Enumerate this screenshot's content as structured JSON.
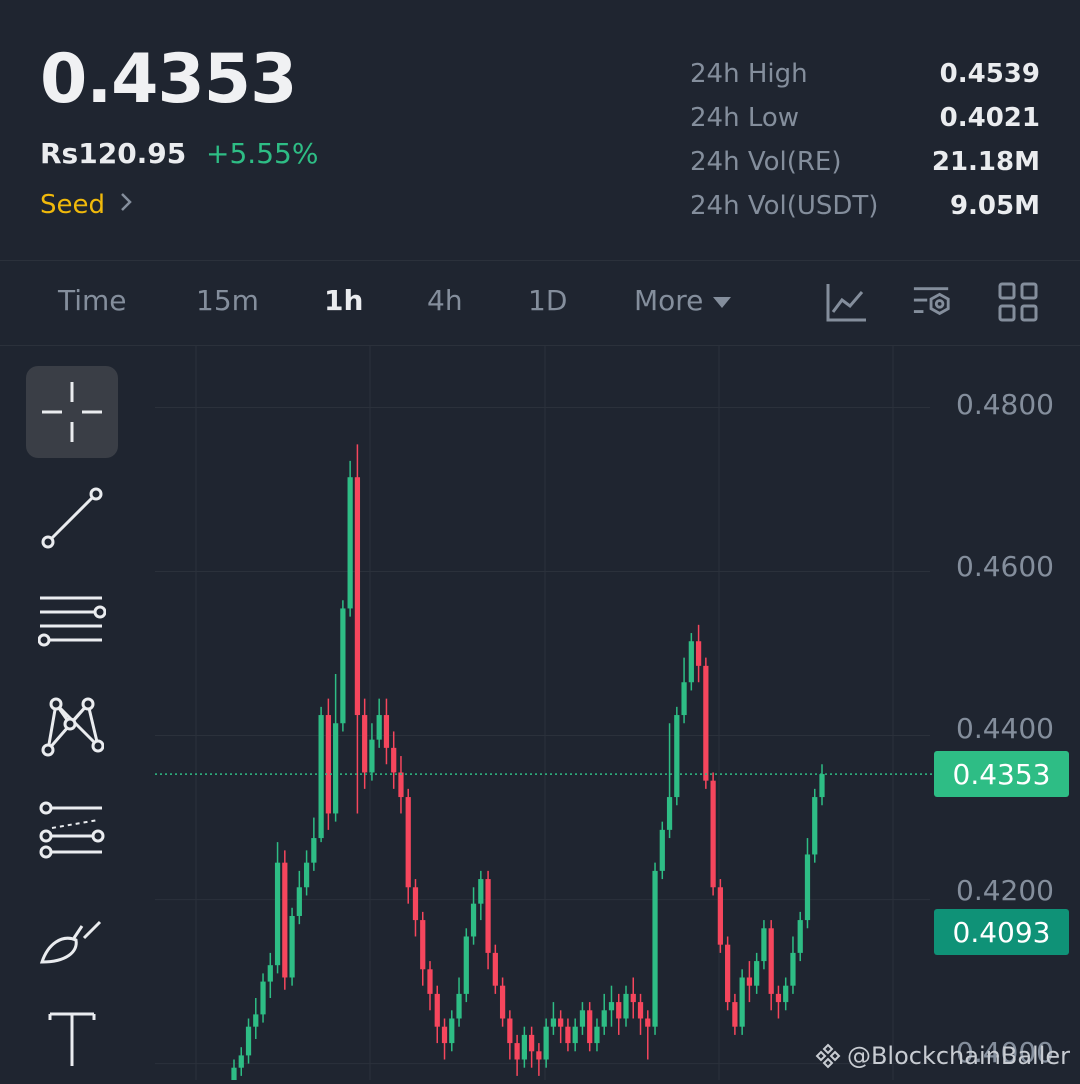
{
  "header": {
    "price": "0.4353",
    "fiat_price": "Rs120.95",
    "change": "+5.55%",
    "tag": "Seed",
    "stats": [
      {
        "label": "24h High",
        "value": "0.4539"
      },
      {
        "label": "24h Low",
        "value": "0.4021"
      },
      {
        "label": "24h Vol(RE)",
        "value": "21.18M"
      },
      {
        "label": "24h Vol(USDT)",
        "value": "9.05M"
      }
    ]
  },
  "tabs": {
    "items": [
      "Time",
      "15m",
      "1h",
      "4h",
      "1D",
      "More"
    ],
    "active": "1h"
  },
  "toolbar_icons": [
    "indicator-chart-icon",
    "settings-filter-icon",
    "layout-grid-icon"
  ],
  "sidebar_tools": [
    "crosshair-icon",
    "trend-line-icon",
    "horizontal-lines-icon",
    "pattern-icon",
    "fib-channel-icon",
    "brush-icon",
    "text-icon"
  ],
  "chart_data": {
    "type": "candlestick",
    "y_ticks": [
      "0.4800",
      "0.4600",
      "0.4400",
      "0.4200",
      "0.4000"
    ],
    "y_tick_values": [
      0.48,
      0.46,
      0.44,
      0.42,
      0.4
    ],
    "ylim": [
      0.398,
      0.4875
    ],
    "current_price": "0.4353",
    "current_price_value": 0.4353,
    "secondary_price": "0.4093",
    "secondary_price_value": 0.4093,
    "colors": {
      "up": "#2ebd85",
      "down": "#f6465d"
    },
    "candles": [
      [
        0.398,
        0.3995,
        0.397,
        0.4005
      ],
      [
        0.3995,
        0.401,
        0.3985,
        0.402
      ],
      [
        0.401,
        0.4045,
        0.4,
        0.4055
      ],
      [
        0.4045,
        0.406,
        0.403,
        0.408
      ],
      [
        0.406,
        0.41,
        0.405,
        0.411
      ],
      [
        0.41,
        0.412,
        0.408,
        0.4135
      ],
      [
        0.412,
        0.4245,
        0.411,
        0.427
      ],
      [
        0.4245,
        0.4105,
        0.409,
        0.426
      ],
      [
        0.4105,
        0.418,
        0.4095,
        0.419
      ],
      [
        0.418,
        0.4215,
        0.417,
        0.4235
      ],
      [
        0.4215,
        0.4245,
        0.4205,
        0.426
      ],
      [
        0.4245,
        0.4275,
        0.4235,
        0.43
      ],
      [
        0.4275,
        0.4425,
        0.427,
        0.4435
      ],
      [
        0.4425,
        0.4305,
        0.4285,
        0.4445
      ],
      [
        0.4305,
        0.4415,
        0.4295,
        0.4475
      ],
      [
        0.4415,
        0.4555,
        0.4405,
        0.4565
      ],
      [
        0.4555,
        0.4715,
        0.4545,
        0.4735
      ],
      [
        0.4715,
        0.4425,
        0.4305,
        0.4755
      ],
      [
        0.4425,
        0.4355,
        0.4335,
        0.4445
      ],
      [
        0.4355,
        0.4395,
        0.4345,
        0.4415
      ],
      [
        0.4395,
        0.4425,
        0.4385,
        0.4445
      ],
      [
        0.4425,
        0.4385,
        0.4365,
        0.4445
      ],
      [
        0.4385,
        0.4355,
        0.4335,
        0.4405
      ],
      [
        0.4355,
        0.4325,
        0.4305,
        0.4375
      ],
      [
        0.4325,
        0.4215,
        0.4195,
        0.4335
      ],
      [
        0.4215,
        0.4175,
        0.4155,
        0.4225
      ],
      [
        0.4175,
        0.4115,
        0.4095,
        0.4185
      ],
      [
        0.4115,
        0.4085,
        0.4065,
        0.4125
      ],
      [
        0.4085,
        0.4045,
        0.4025,
        0.4095
      ],
      [
        0.4045,
        0.4025,
        0.4005,
        0.4055
      ],
      [
        0.4025,
        0.4055,
        0.4015,
        0.4065
      ],
      [
        0.4055,
        0.4085,
        0.4045,
        0.4105
      ],
      [
        0.4085,
        0.4155,
        0.4075,
        0.4165
      ],
      [
        0.4155,
        0.4195,
        0.4145,
        0.4215
      ],
      [
        0.4195,
        0.4225,
        0.4175,
        0.4235
      ],
      [
        0.4225,
        0.4135,
        0.4115,
        0.4235
      ],
      [
        0.4135,
        0.4095,
        0.4085,
        0.4145
      ],
      [
        0.4095,
        0.4055,
        0.4045,
        0.4105
      ],
      [
        0.4055,
        0.4025,
        0.4005,
        0.4065
      ],
      [
        0.4025,
        0.4005,
        0.3985,
        0.4035
      ],
      [
        0.4005,
        0.4035,
        0.3995,
        0.4045
      ],
      [
        0.4035,
        0.4015,
        0.3995,
        0.4045
      ],
      [
        0.4015,
        0.4005,
        0.3985,
        0.4025
      ],
      [
        0.4005,
        0.4045,
        0.3995,
        0.4055
      ],
      [
        0.4045,
        0.4055,
        0.4035,
        0.4075
      ],
      [
        0.4055,
        0.4045,
        0.4025,
        0.4065
      ],
      [
        0.4045,
        0.4025,
        0.4015,
        0.4055
      ],
      [
        0.4025,
        0.4045,
        0.4015,
        0.4055
      ],
      [
        0.4045,
        0.4065,
        0.4035,
        0.4075
      ],
      [
        0.4065,
        0.4025,
        0.4015,
        0.4075
      ],
      [
        0.4025,
        0.4045,
        0.4015,
        0.4055
      ],
      [
        0.4045,
        0.4065,
        0.4035,
        0.4085
      ],
      [
        0.4065,
        0.4075,
        0.4045,
        0.4095
      ],
      [
        0.4075,
        0.4055,
        0.4035,
        0.4085
      ],
      [
        0.4055,
        0.4085,
        0.4045,
        0.4095
      ],
      [
        0.4085,
        0.4075,
        0.4055,
        0.4105
      ],
      [
        0.4075,
        0.4055,
        0.4035,
        0.4085
      ],
      [
        0.4055,
        0.4045,
        0.4005,
        0.4065
      ],
      [
        0.4045,
        0.4235,
        0.4035,
        0.4245
      ],
      [
        0.4235,
        0.4285,
        0.4225,
        0.4295
      ],
      [
        0.4285,
        0.4325,
        0.4275,
        0.4415
      ],
      [
        0.4325,
        0.4425,
        0.4315,
        0.4435
      ],
      [
        0.4425,
        0.4465,
        0.4415,
        0.4495
      ],
      [
        0.4465,
        0.4515,
        0.4455,
        0.4525
      ],
      [
        0.4515,
        0.4485,
        0.4465,
        0.4535
      ],
      [
        0.4485,
        0.4345,
        0.4335,
        0.4495
      ],
      [
        0.4345,
        0.4215,
        0.4205,
        0.4355
      ],
      [
        0.4215,
        0.4145,
        0.4135,
        0.4225
      ],
      [
        0.4145,
        0.4075,
        0.4065,
        0.4155
      ],
      [
        0.4075,
        0.4045,
        0.4035,
        0.4085
      ],
      [
        0.4045,
        0.4105,
        0.4035,
        0.4115
      ],
      [
        0.4105,
        0.4095,
        0.4075,
        0.4125
      ],
      [
        0.4095,
        0.4125,
        0.4085,
        0.4135
      ],
      [
        0.4125,
        0.4165,
        0.4115,
        0.4175
      ],
      [
        0.4165,
        0.4085,
        0.4065,
        0.4175
      ],
      [
        0.4085,
        0.4075,
        0.4055,
        0.4095
      ],
      [
        0.4075,
        0.4095,
        0.4065,
        0.4105
      ],
      [
        0.4095,
        0.4135,
        0.4085,
        0.4155
      ],
      [
        0.4135,
        0.4175,
        0.4125,
        0.4185
      ],
      [
        0.4175,
        0.4255,
        0.4165,
        0.4275
      ],
      [
        0.4255,
        0.4325,
        0.4245,
        0.4335
      ],
      [
        0.4325,
        0.4353,
        0.4315,
        0.4365
      ]
    ]
  },
  "watermark": "@BlockchainBaller"
}
